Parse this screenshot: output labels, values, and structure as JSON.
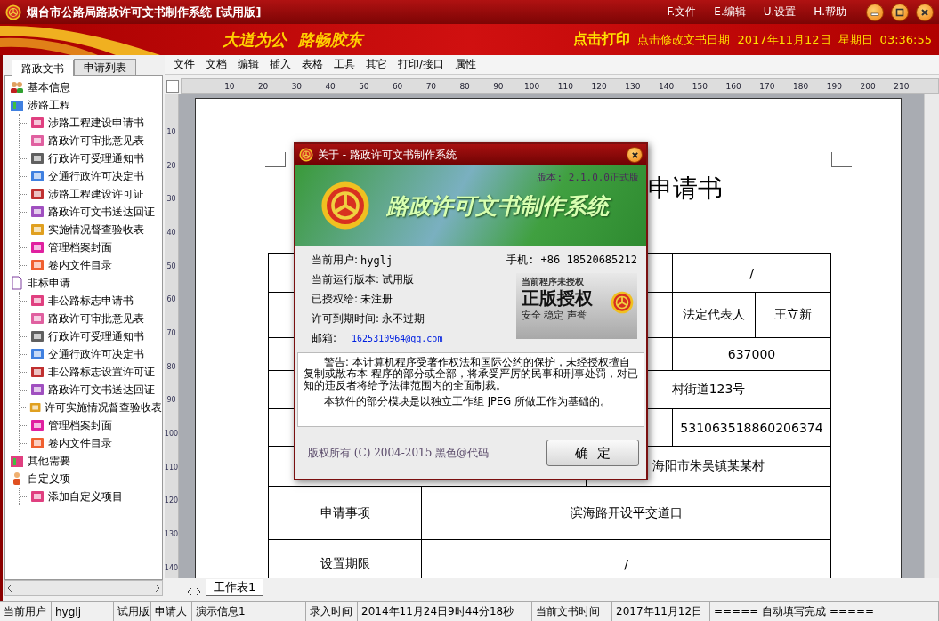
{
  "window": {
    "title": "烟台市公路局路政许可文书制作系统 [试用版]",
    "menu": [
      "F.文件",
      "E.编辑",
      "U.设置",
      "H.帮助"
    ]
  },
  "banner": {
    "slogan": "大道为公  路畅胶东",
    "print": "点击打印",
    "edit_date": "点击修改文书日期",
    "date": "2017年11月12日",
    "weekday": "星期日",
    "time": "03:36:55"
  },
  "sidebar": {
    "tabs": [
      {
        "label": "路政文书",
        "selected": true
      },
      {
        "label": "申请列表",
        "selected": false
      }
    ],
    "tree": [
      {
        "label": "基本信息"
      },
      {
        "label": "涉路工程",
        "children": [
          {
            "label": "涉路工程建设申请书"
          },
          {
            "label": "路政许可审批意见表"
          },
          {
            "label": "行政许可受理通知书"
          },
          {
            "label": "交通行政许可决定书"
          },
          {
            "label": "涉路工程建设许可证"
          },
          {
            "label": "路政许可文书送达回证"
          },
          {
            "label": "实施情况督查验收表"
          },
          {
            "label": "管理档案封面"
          },
          {
            "label": "卷内文件目录"
          }
        ]
      },
      {
        "label": "非标申请",
        "children": [
          {
            "label": "非公路标志申请书"
          },
          {
            "label": "路政许可审批意见表"
          },
          {
            "label": "行政许可受理通知书"
          },
          {
            "label": "交通行政许可决定书"
          },
          {
            "label": "非公路标志设置许可证"
          },
          {
            "label": "路政许可文书送达回证"
          },
          {
            "label": "许可实施情况督查验收表"
          },
          {
            "label": "管理档案封面"
          },
          {
            "label": "卷内文件目录"
          }
        ]
      },
      {
        "label": "其他需要"
      },
      {
        "label": "自定义项",
        "children": [
          {
            "label": "添加自定义项目"
          }
        ]
      }
    ]
  },
  "editor": {
    "menu": [
      "文件",
      "文档",
      "编辑",
      "插入",
      "表格",
      "工具",
      "其它",
      "打印/接口",
      "属性"
    ],
    "ruler_h": [
      "10",
      "20",
      "30",
      "40",
      "50",
      "60",
      "70",
      "80",
      "90",
      "100",
      "110",
      "120",
      "130",
      "140",
      "150",
      "160",
      "170",
      "180",
      "190",
      "200",
      "210"
    ],
    "ruler_v": [
      "10",
      "20",
      "30",
      "40",
      "50",
      "60",
      "70",
      "80",
      "90",
      "100",
      "110",
      "120",
      "130",
      "140"
    ],
    "document": {
      "title": "申请书",
      "rows": [
        {
          "kind": "value",
          "value": "/"
        },
        {
          "kind": "pair",
          "label": "法定代表人",
          "value": "王立新"
        },
        {
          "kind": "value",
          "value": "637000"
        },
        {
          "kind": "mid",
          "value": "村街道123号"
        },
        {
          "kind": "value",
          "value": "531063518860206374"
        },
        {
          "kind": "mid",
          "value": "海阳市朱吴镇某某村"
        },
        {
          "kind": "wide",
          "label": "申请事项",
          "value": "滨海路开设平交道口"
        },
        {
          "kind": "wide",
          "label": "设置期限",
          "value": "/"
        }
      ]
    },
    "sheet_tab": "工作表1"
  },
  "dialog": {
    "title": "关于 - 路政许可文书制作系统",
    "version": "版本: 2.1.0.0正式版",
    "product": "路政许可文书制作系统",
    "info": [
      {
        "label": "当前用户:",
        "value": "hyglj"
      },
      {
        "label": "当前运行版本:",
        "value": "试用版"
      },
      {
        "label": "已授权给:",
        "value": "未注册"
      },
      {
        "label": "许可到期时间:",
        "value": "永不过期"
      }
    ],
    "email_label": "邮箱:",
    "email": "1625310964@qq.com",
    "phone": "手机: +86 18520685212",
    "badge": {
      "top": "当前程序未授权",
      "main": "正版授权",
      "bottom": "安全 稳定 声誉"
    },
    "warning": [
      "警告: 本计算机程序受著作权法和国际公约的保护，未经授权擅自复制或散布本 程序的部分或全部，将承受严厉的民事和刑事处罚，对已知的违反者将给予法律范围内的全面制裁。",
      "本软件的部分模块是以独立工作组 JPEG 所做工作为基础的。"
    ],
    "copyright": "版权所有 (C) 2004-2015 黑色@代码",
    "ok": "确  定"
  },
  "status_bar": [
    "当前用户",
    "hyglj",
    "试用版",
    "申请人",
    "演示信息1",
    "录入时间",
    "2014年11月24日9时44分18秒",
    "当前文书时间",
    "2017年11月12日",
    "===== 自动填写完成 ====="
  ]
}
